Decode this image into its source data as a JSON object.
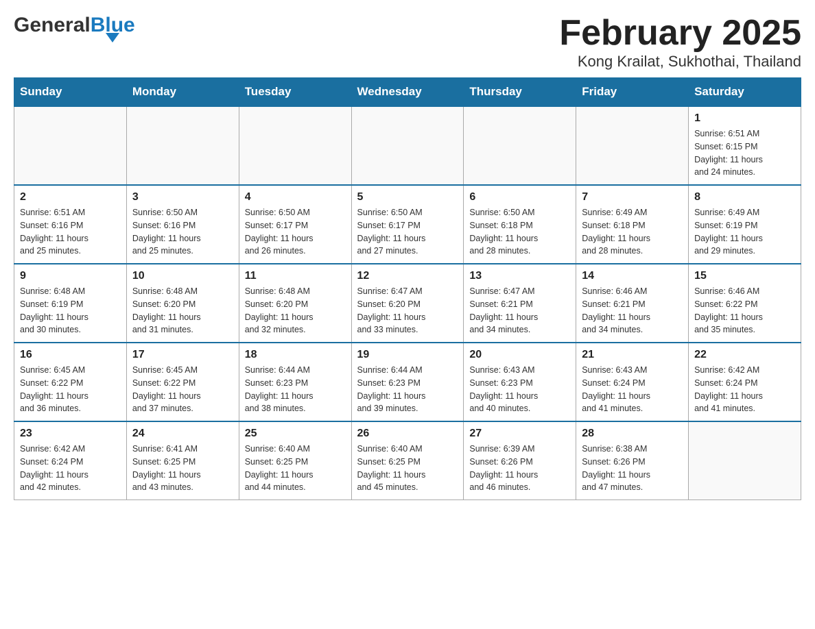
{
  "header": {
    "logo_general": "General",
    "logo_blue": "Blue",
    "month_title": "February 2025",
    "location": "Kong Krailat, Sukhothai, Thailand"
  },
  "weekdays": [
    "Sunday",
    "Monday",
    "Tuesday",
    "Wednesday",
    "Thursday",
    "Friday",
    "Saturday"
  ],
  "weeks": [
    [
      {
        "day": "",
        "info": ""
      },
      {
        "day": "",
        "info": ""
      },
      {
        "day": "",
        "info": ""
      },
      {
        "day": "",
        "info": ""
      },
      {
        "day": "",
        "info": ""
      },
      {
        "day": "",
        "info": ""
      },
      {
        "day": "1",
        "info": "Sunrise: 6:51 AM\nSunset: 6:15 PM\nDaylight: 11 hours\nand 24 minutes."
      }
    ],
    [
      {
        "day": "2",
        "info": "Sunrise: 6:51 AM\nSunset: 6:16 PM\nDaylight: 11 hours\nand 25 minutes."
      },
      {
        "day": "3",
        "info": "Sunrise: 6:50 AM\nSunset: 6:16 PM\nDaylight: 11 hours\nand 25 minutes."
      },
      {
        "day": "4",
        "info": "Sunrise: 6:50 AM\nSunset: 6:17 PM\nDaylight: 11 hours\nand 26 minutes."
      },
      {
        "day": "5",
        "info": "Sunrise: 6:50 AM\nSunset: 6:17 PM\nDaylight: 11 hours\nand 27 minutes."
      },
      {
        "day": "6",
        "info": "Sunrise: 6:50 AM\nSunset: 6:18 PM\nDaylight: 11 hours\nand 28 minutes."
      },
      {
        "day": "7",
        "info": "Sunrise: 6:49 AM\nSunset: 6:18 PM\nDaylight: 11 hours\nand 28 minutes."
      },
      {
        "day": "8",
        "info": "Sunrise: 6:49 AM\nSunset: 6:19 PM\nDaylight: 11 hours\nand 29 minutes."
      }
    ],
    [
      {
        "day": "9",
        "info": "Sunrise: 6:48 AM\nSunset: 6:19 PM\nDaylight: 11 hours\nand 30 minutes."
      },
      {
        "day": "10",
        "info": "Sunrise: 6:48 AM\nSunset: 6:20 PM\nDaylight: 11 hours\nand 31 minutes."
      },
      {
        "day": "11",
        "info": "Sunrise: 6:48 AM\nSunset: 6:20 PM\nDaylight: 11 hours\nand 32 minutes."
      },
      {
        "day": "12",
        "info": "Sunrise: 6:47 AM\nSunset: 6:20 PM\nDaylight: 11 hours\nand 33 minutes."
      },
      {
        "day": "13",
        "info": "Sunrise: 6:47 AM\nSunset: 6:21 PM\nDaylight: 11 hours\nand 34 minutes."
      },
      {
        "day": "14",
        "info": "Sunrise: 6:46 AM\nSunset: 6:21 PM\nDaylight: 11 hours\nand 34 minutes."
      },
      {
        "day": "15",
        "info": "Sunrise: 6:46 AM\nSunset: 6:22 PM\nDaylight: 11 hours\nand 35 minutes."
      }
    ],
    [
      {
        "day": "16",
        "info": "Sunrise: 6:45 AM\nSunset: 6:22 PM\nDaylight: 11 hours\nand 36 minutes."
      },
      {
        "day": "17",
        "info": "Sunrise: 6:45 AM\nSunset: 6:22 PM\nDaylight: 11 hours\nand 37 minutes."
      },
      {
        "day": "18",
        "info": "Sunrise: 6:44 AM\nSunset: 6:23 PM\nDaylight: 11 hours\nand 38 minutes."
      },
      {
        "day": "19",
        "info": "Sunrise: 6:44 AM\nSunset: 6:23 PM\nDaylight: 11 hours\nand 39 minutes."
      },
      {
        "day": "20",
        "info": "Sunrise: 6:43 AM\nSunset: 6:23 PM\nDaylight: 11 hours\nand 40 minutes."
      },
      {
        "day": "21",
        "info": "Sunrise: 6:43 AM\nSunset: 6:24 PM\nDaylight: 11 hours\nand 41 minutes."
      },
      {
        "day": "22",
        "info": "Sunrise: 6:42 AM\nSunset: 6:24 PM\nDaylight: 11 hours\nand 41 minutes."
      }
    ],
    [
      {
        "day": "23",
        "info": "Sunrise: 6:42 AM\nSunset: 6:24 PM\nDaylight: 11 hours\nand 42 minutes."
      },
      {
        "day": "24",
        "info": "Sunrise: 6:41 AM\nSunset: 6:25 PM\nDaylight: 11 hours\nand 43 minutes."
      },
      {
        "day": "25",
        "info": "Sunrise: 6:40 AM\nSunset: 6:25 PM\nDaylight: 11 hours\nand 44 minutes."
      },
      {
        "day": "26",
        "info": "Sunrise: 6:40 AM\nSunset: 6:25 PM\nDaylight: 11 hours\nand 45 minutes."
      },
      {
        "day": "27",
        "info": "Sunrise: 6:39 AM\nSunset: 6:26 PM\nDaylight: 11 hours\nand 46 minutes."
      },
      {
        "day": "28",
        "info": "Sunrise: 6:38 AM\nSunset: 6:26 PM\nDaylight: 11 hours\nand 47 minutes."
      },
      {
        "day": "",
        "info": ""
      }
    ]
  ]
}
